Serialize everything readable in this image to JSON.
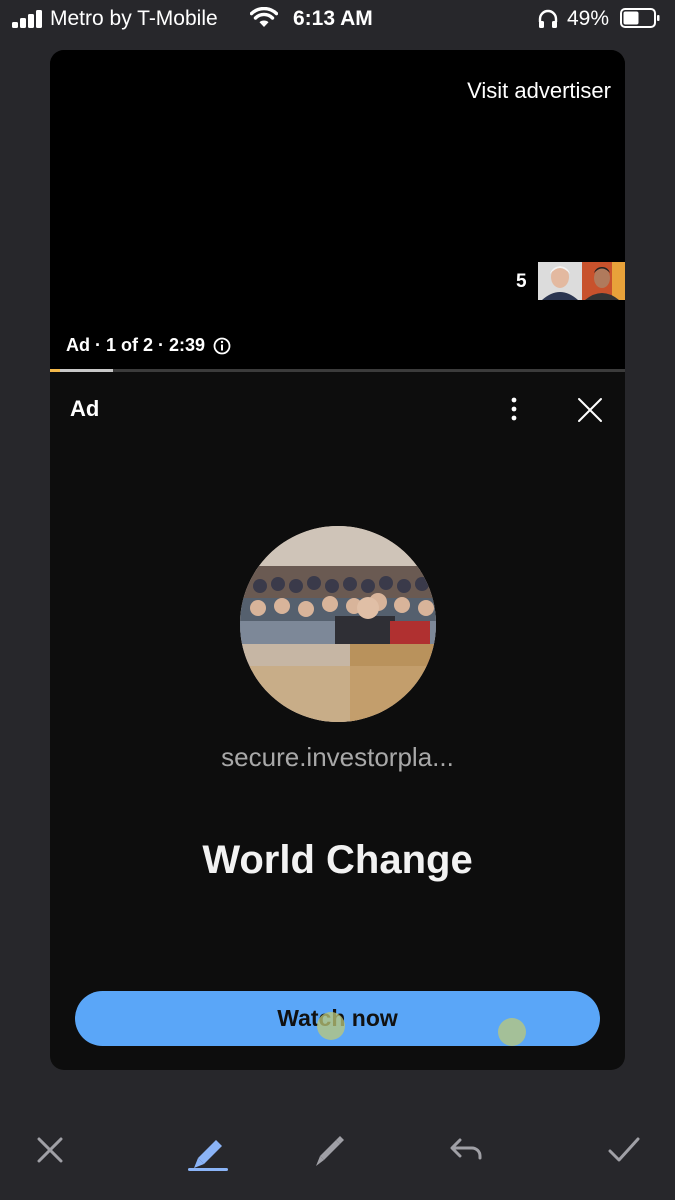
{
  "status": {
    "carrier": "Metro by T-Mobile",
    "time": "6:13 AM",
    "battery": "49%",
    "icons": [
      "signal-icon",
      "wifi-icon",
      "headphones-icon",
      "battery-icon"
    ]
  },
  "ad": {
    "visit_label": "Visit advertiser",
    "queue_count": "5",
    "meta": "Ad · 1 of 2 · 2:39",
    "progress_fraction": 0.11,
    "label": "Ad",
    "domain": "secure.investorpla...",
    "headline": "World Change",
    "cta_label": "Watch now"
  },
  "toolbar": {
    "icons": [
      "close-icon",
      "highlighter-icon",
      "pen-icon",
      "undo-icon",
      "check-icon"
    ]
  },
  "colors": {
    "accent": "#5aa6f8",
    "card": "#0d0d0d",
    "background": "#27272b"
  }
}
